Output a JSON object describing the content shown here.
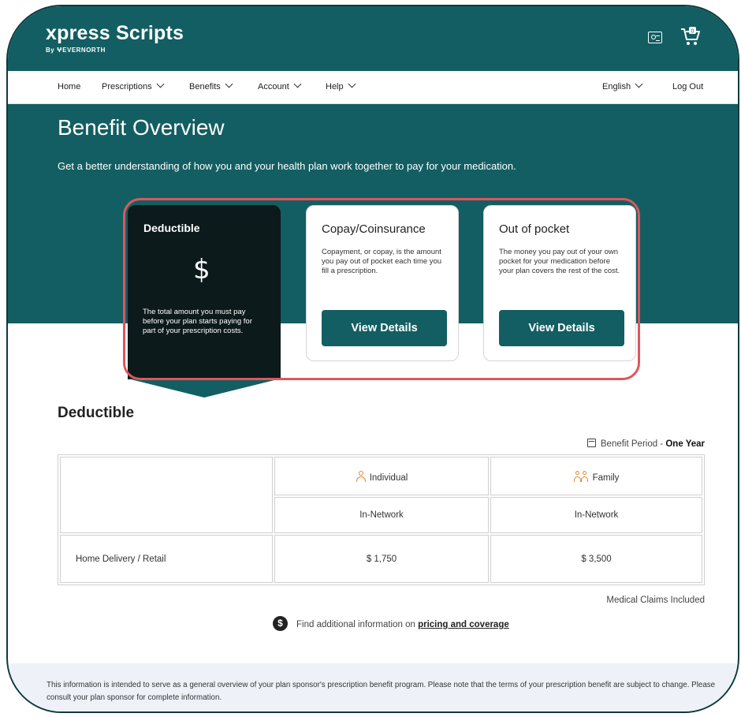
{
  "header": {
    "logo_name": "xpress Scripts",
    "logo_sub": "By ⵖEVERNORTH",
    "id_card_icon": "id-card-icon",
    "cart_icon": "cart-icon",
    "cart_count": "0"
  },
  "nav": {
    "home": "Home",
    "prescriptions": "Prescriptions",
    "benefits": "Benefits",
    "account": "Account",
    "help": "Help",
    "language": "English",
    "logout": "Log Out"
  },
  "hero": {
    "title": "Benefit Overview",
    "lead": "Get a better understanding of how you and your health plan work together to pay for your medication."
  },
  "cards": [
    {
      "title": "Deductible",
      "symbol": "$",
      "description": "The total amount you must pay before your plan starts paying for part of your prescription costs."
    },
    {
      "title": "Copay/Coinsurance",
      "description": "Copayment, or copay, is the amount you pay out of pocket each time you fill a prescription.",
      "button": "View Details"
    },
    {
      "title": "Out of pocket",
      "description": "The money you pay out of your own pocket for your medication before your plan covers the rest of the cost.",
      "button": "View Details"
    }
  ],
  "deductible": {
    "title": "Deductible",
    "period_label": "Benefit Period - ",
    "period_value": "One Year",
    "columns": [
      "Individual",
      "Family"
    ],
    "network_label": "In-Network",
    "rows": [
      {
        "label": "Home Delivery / Retail",
        "individual": "$ 1,750",
        "family": "$ 3,500"
      }
    ],
    "claims_note": "Medical Claims Included",
    "additional_text": "Find additional information on ",
    "additional_link": "pricing and coverage"
  },
  "disclaimer": "This information is intended to serve as a general overview of your plan sponsor's prescription benefit program. Please note that the terms of your prescription benefit are subject to change. Please consult your plan sponsor for complete information.",
  "colors": {
    "brand_teal": "#135e62",
    "active_card": "#0c1a1b",
    "highlight_outline": "#e0555c",
    "icon_orange": "#e08a2c"
  }
}
